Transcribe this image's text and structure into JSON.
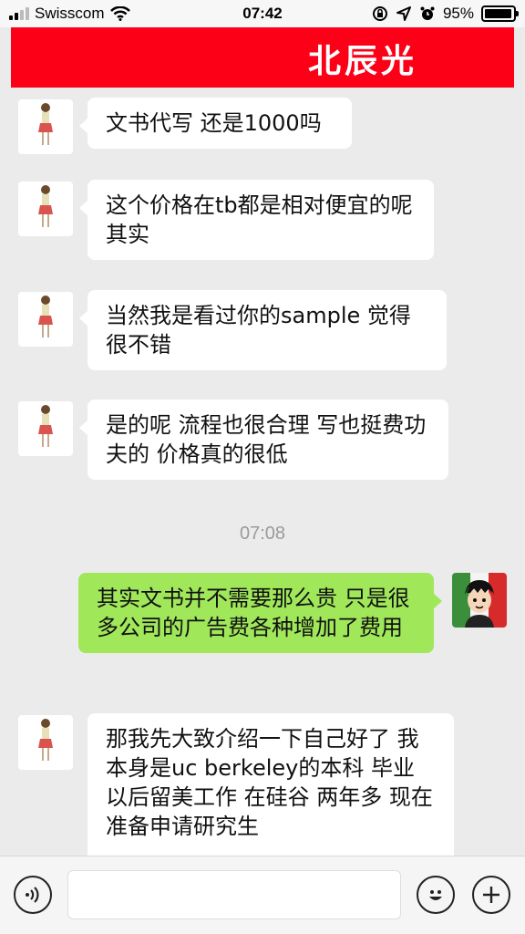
{
  "status_bar": {
    "carrier": "Swisscom",
    "time": "07:42",
    "battery": "95%",
    "battery_level": 0.95,
    "signal_bars": 4,
    "signal_filled": 2
  },
  "header": {
    "title": "北辰光",
    "background": "#fb0016"
  },
  "messages": [
    {
      "side": "left",
      "text": "文书代写 还是1000吗"
    },
    {
      "side": "left",
      "text": "这个价格在tb都是相对便宜的呢其实"
    },
    {
      "side": "left",
      "text": "当然我是看过你的sample 觉得很不错"
    },
    {
      "side": "left",
      "text": "是的呢 流程也很合理 写也挺费功夫的 价格真的很低"
    },
    {
      "type": "timestamp",
      "text": "07:08"
    },
    {
      "side": "right",
      "text": "其实文书并不需要那么贵 只是很多公司的广告费各种增加了费用"
    },
    {
      "side": "left",
      "text": "那我先大致介绍一下自己好了 我本身是uc berkeley的本科 毕业以后留美工作 在硅谷 两年多 现在准备申请研究生"
    }
  ],
  "input_bar": {
    "voice_icon": "voice-icon",
    "emoji_icon": "emoji-icon",
    "plus_icon": "plus-icon"
  },
  "colors": {
    "outgoing_bubble": "#a0e75a",
    "incoming_bubble": "#ffffff",
    "chat_background": "#ebebeb"
  }
}
